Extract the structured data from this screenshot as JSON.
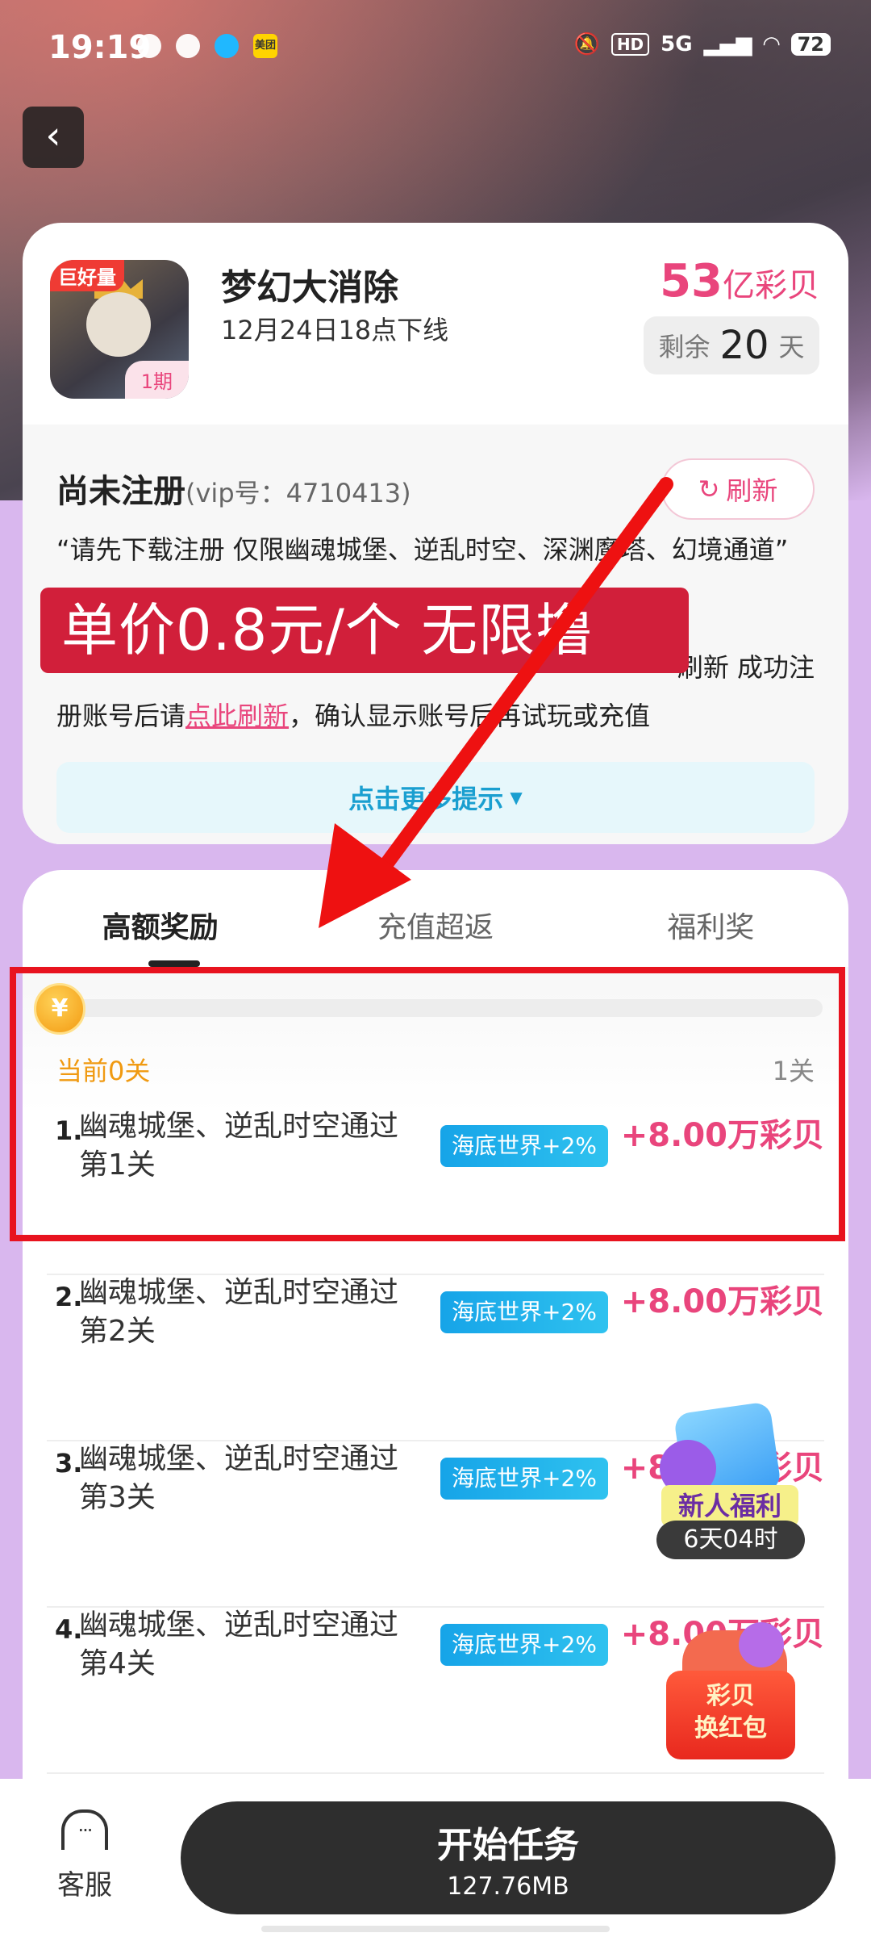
{
  "status_bar": {
    "time": "19:19",
    "left_icons": [
      "wechat-icon",
      "sports-icon",
      "qq-icon",
      "meituan-icon"
    ],
    "meituan_label": "美团",
    "hd": "HD",
    "network": "5G",
    "battery": "72"
  },
  "game": {
    "name": "梦幻大消除",
    "offline": "12月24日18点下线",
    "icon_tag": "巨好量",
    "period": "1期",
    "total_reward_num": "53",
    "total_reward_unit": "亿彩贝",
    "remain_prefix": "剩余",
    "remain_days": "20",
    "remain_suffix": "天"
  },
  "registration": {
    "status": "尚未注册",
    "vip": "(vip号：4710413)",
    "refresh_label": "刷新",
    "quote": "“请先下载注册 仅限幽魂城堡、逆乱时空、深渊魔塔、幻境通道”",
    "tip_line1": "刷新 成功注",
    "tip_line2_a": "册账号后请",
    "tip_line2_link": "点此刷新",
    "tip_line2_b": "，确认显示账号后再试玩或充值",
    "more_tips": "点击更多提示"
  },
  "promo": {
    "text": "单价0.8元/个 无限撸"
  },
  "tabs": [
    "高额奖励",
    "充值超返",
    "福利奖"
  ],
  "progress": {
    "current_label": "当前0关",
    "target_label": "1关",
    "fraction": 0,
    "coin": "¥"
  },
  "tasks": [
    {
      "num": "1.",
      "text": "幽魂城堡、逆乱时空通过第1关",
      "badge": "海底世界+2%",
      "reward": "+8.00万彩贝"
    },
    {
      "num": "2.",
      "text": "幽魂城堡、逆乱时空通过第2关",
      "badge": "海底世界+2%",
      "reward": "+8.00万彩贝"
    },
    {
      "num": "3.",
      "text": "幽魂城堡、逆乱时空通过第3关",
      "badge": "海底世界+2%",
      "reward": "+8.00万彩贝"
    },
    {
      "num": "4.",
      "text": "幽魂城堡、逆乱时空通过第4关",
      "badge": "海底世界+2%",
      "reward": "+8.00万彩贝"
    }
  ],
  "floats": {
    "new_user_label": "新人福利",
    "new_user_timer": "6天04时",
    "redpack_line1": "彩贝",
    "redpack_line2": "换红包"
  },
  "bottom": {
    "cs_label": "客服",
    "start_label": "开始任务",
    "size": "127.76MB"
  },
  "colors": {
    "accent_pink": "#e9457c",
    "promo_red": "#d11f3a",
    "frame_red": "#e8131f",
    "badge_blue": "#16a4e8"
  }
}
